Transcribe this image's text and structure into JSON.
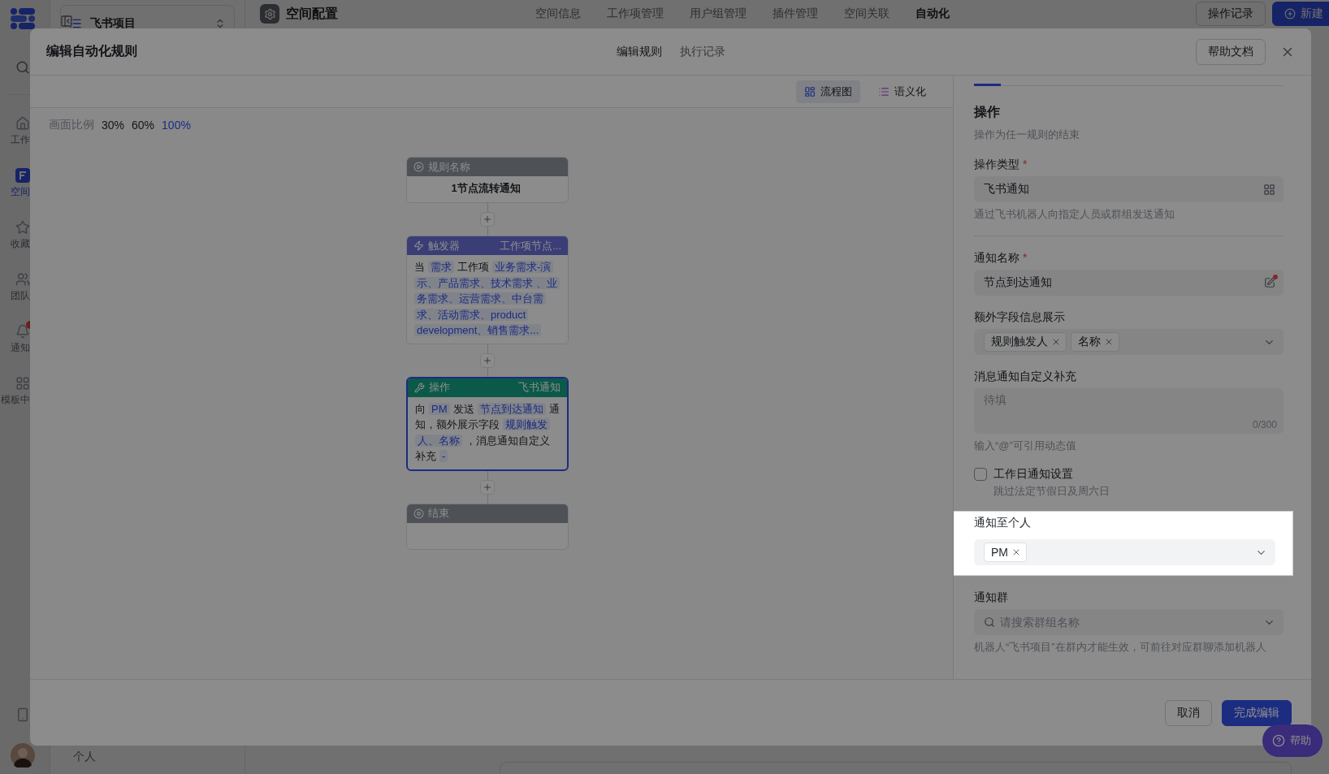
{
  "rail": {
    "items": [
      {
        "label": "工作",
        "selected": false,
        "badge": false
      },
      {
        "label": "空间",
        "selected": true,
        "badge": false
      },
      {
        "label": "收藏",
        "selected": false,
        "badge": false
      },
      {
        "label": "团队",
        "selected": false,
        "badge": false
      },
      {
        "label": "通知",
        "selected": false,
        "badge": true
      },
      {
        "label": "模板中",
        "selected": false,
        "badge": false
      }
    ]
  },
  "sidebar": {
    "project": "飞书项目",
    "footer_item": "个人"
  },
  "header": {
    "title": "空间配置",
    "tabs": [
      {
        "label": "空间信息",
        "selected": false
      },
      {
        "label": "工作项管理",
        "selected": false
      },
      {
        "label": "用户组管理",
        "selected": false
      },
      {
        "label": "插件管理",
        "selected": false
      },
      {
        "label": "空间关联",
        "selected": false
      },
      {
        "label": "自动化",
        "selected": true
      }
    ],
    "buttons": [
      {
        "label": "操作记录",
        "kind": "secondary"
      },
      {
        "label": "新建",
        "kind": "primary"
      }
    ]
  },
  "modal": {
    "title": "编辑自动化规则",
    "tabs": [
      {
        "label": "编辑规则",
        "selected": true
      },
      {
        "label": "执行记录",
        "selected": false
      }
    ],
    "help_button": "帮助文档",
    "view_switch": [
      {
        "label": "流程图",
        "selected": true
      },
      {
        "label": "语义化",
        "selected": false
      }
    ],
    "zoom": {
      "label": "画面比例",
      "options": [
        {
          "label": "30%",
          "selected": false
        },
        {
          "label": "60%",
          "selected": false
        },
        {
          "label": "100%",
          "selected": true
        }
      ]
    },
    "flow_nodes": [
      {
        "kind": "start",
        "title": "规则名称",
        "selected": false,
        "body": [
          {
            "kind": "text",
            "text": "1节点流转通知"
          }
        ]
      },
      {
        "kind": "trigger",
        "title": "触发器",
        "subtitle": "工作项节点...",
        "selected": false,
        "body": [
          {
            "kind": "text",
            "text": "当"
          },
          {
            "kind": "token",
            "text": "需求"
          },
          {
            "kind": "text",
            "text": "工作项"
          },
          {
            "kind": "token",
            "text": "业务需求-演示、产品需求、技术需求 、业务需求、运营需求、中台需求、活动需求、product development、销售需求..."
          }
        ]
      },
      {
        "kind": "action",
        "title": "操作",
        "subtitle": "飞书通知",
        "selected": true,
        "body": [
          {
            "kind": "text",
            "text": "向"
          },
          {
            "kind": "token",
            "text": "PM"
          },
          {
            "kind": "text",
            "text": "发送"
          },
          {
            "kind": "token",
            "text": "节点到达通知"
          },
          {
            "kind": "text",
            "text": "通知，额外展示字段"
          },
          {
            "kind": "token",
            "text": "规则触发人、名称"
          },
          {
            "kind": "text",
            "text": "，消息通知自定义补充"
          },
          {
            "kind": "token",
            "text": "-"
          }
        ]
      },
      {
        "kind": "end",
        "title": "结束",
        "selected": false
      }
    ],
    "panel": {
      "section_title": "操作",
      "section_desc": "操作为任一规则的结束",
      "fields": [
        {
          "kind": "select",
          "label": "操作类型",
          "required_mark": "*",
          "value": "飞书通知",
          "help": "通过飞书机器人向指定人员或群组发送通知",
          "highlighted": false
        },
        {
          "kind": "divider"
        },
        {
          "kind": "input",
          "label": "通知名称",
          "required_mark": "*",
          "value": "节点到达通知",
          "highlighted": false
        },
        {
          "kind": "multiselect",
          "label": "额外字段信息展示",
          "tags": [
            "规则触发人",
            "名称"
          ],
          "highlighted": false
        },
        {
          "kind": "textarea",
          "label": "消息通知自定义补充",
          "placeholder": "待填",
          "counter": "0/300",
          "help": "输入“@”可引用动态值",
          "highlighted": false
        },
        {
          "kind": "checkbox",
          "label": "工作日通知设置",
          "checked": false,
          "help": "跳过法定节假日及周六日",
          "highlighted": false
        },
        {
          "kind": "multiselect",
          "label": "通知至个人",
          "tags": [
            "PM"
          ],
          "highlighted": true
        },
        {
          "kind": "search_select",
          "label": "通知群",
          "placeholder": "请搜索群组名称",
          "help": "机器人“飞书项目”在群内才能生效，可前往对应群聊添加机器人",
          "highlighted": false
        }
      ]
    },
    "footer": {
      "buttons": [
        {
          "label": "取消",
          "kind": "secondary"
        },
        {
          "label": "完成编辑",
          "kind": "primary"
        }
      ]
    }
  },
  "help_fab": {
    "label": "帮助"
  }
}
